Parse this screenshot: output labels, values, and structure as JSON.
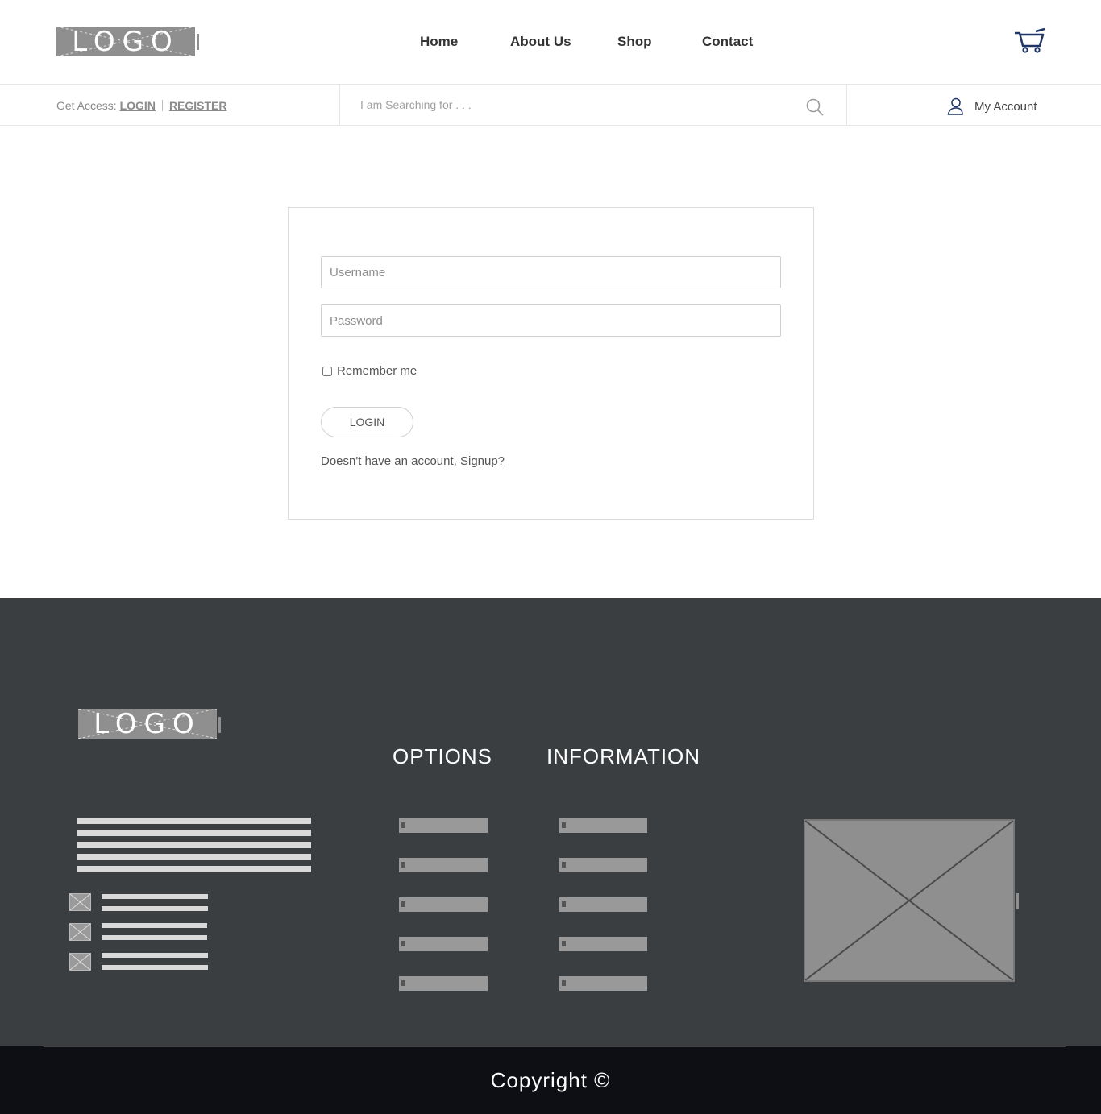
{
  "header": {
    "logo_text": "LOGO",
    "nav": [
      "Home",
      "About Us",
      "Shop",
      "Contact"
    ],
    "cart_icon": "shopping-cart-icon",
    "cart_color": "#1f3566"
  },
  "access_bar": {
    "prefix": "Get Access:",
    "login": "LOGIN",
    "register": "REGISTER",
    "search_placeholder": "I am Searching for . . .",
    "search_icon": "search-icon",
    "account_icon": "user-icon",
    "account_label": "My Account"
  },
  "login_form": {
    "username_placeholder": "Username",
    "password_placeholder": "Password",
    "remember_label": "Remember me",
    "remember_checked": false,
    "login_button": "LOGIN",
    "signup_text": "Doesn't have an account, Signup?"
  },
  "footer": {
    "logo_text": "LOGO",
    "options_heading": "OPTIONS",
    "information_heading": "INFORMATION",
    "background": "#3b3e41"
  },
  "copyright": {
    "text": "Copyright ©",
    "background": "#0e0f15"
  }
}
